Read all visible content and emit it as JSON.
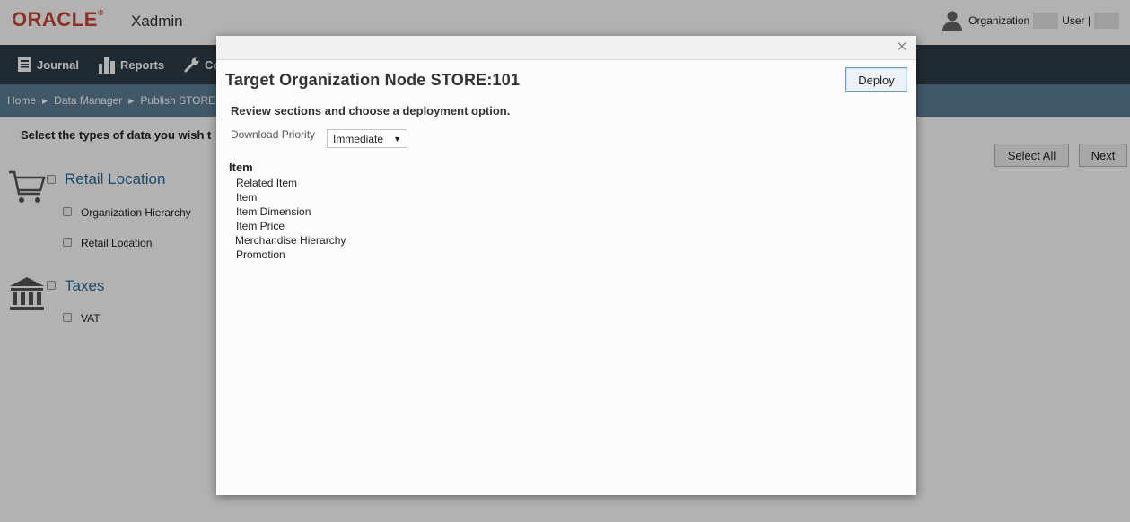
{
  "header": {
    "brand": "ORACLE",
    "brand_mark": "®",
    "app_name": "Xadmin",
    "organization_label": "Organization",
    "user_label": "User |"
  },
  "nav": {
    "items": [
      {
        "label": "Journal",
        "icon": "journal-icon"
      },
      {
        "label": "Reports",
        "icon": "reports-icon"
      },
      {
        "label": "Co",
        "icon": "wrench-icon"
      }
    ]
  },
  "breadcrumb": {
    "items": [
      "Home",
      "Data Manager",
      "Publish STORE"
    ]
  },
  "main": {
    "instruction": "Select the types of data you wish t",
    "select_all_label": "Select All",
    "next_label": "Next",
    "sections": [
      {
        "title": "Retail Location",
        "icon": "cart-icon",
        "items": [
          "Organization Hierarchy",
          "Retail Location"
        ]
      },
      {
        "title": "Taxes",
        "icon": "bank-icon",
        "items": [
          "VAT"
        ]
      }
    ]
  },
  "modal": {
    "title": "Target Organization Node STORE:101",
    "deploy_label": "Deploy",
    "close_glyph": "×",
    "review_text": "Review sections and choose a deployment option.",
    "download_priority_label": "Download Priority",
    "download_priority_value": "Immediate",
    "section_heading": "Item",
    "section_items": [
      "Related Item",
      "Item",
      "Item Dimension",
      "Item Price",
      "Merchandise Hierarchy",
      "Promotion"
    ]
  },
  "colors": {
    "brand_red": "#c74634",
    "nav_bg": "#2f3d48",
    "breadcrumb_bg": "#5d7e97",
    "section_title_blue": "#2b6a9a"
  }
}
